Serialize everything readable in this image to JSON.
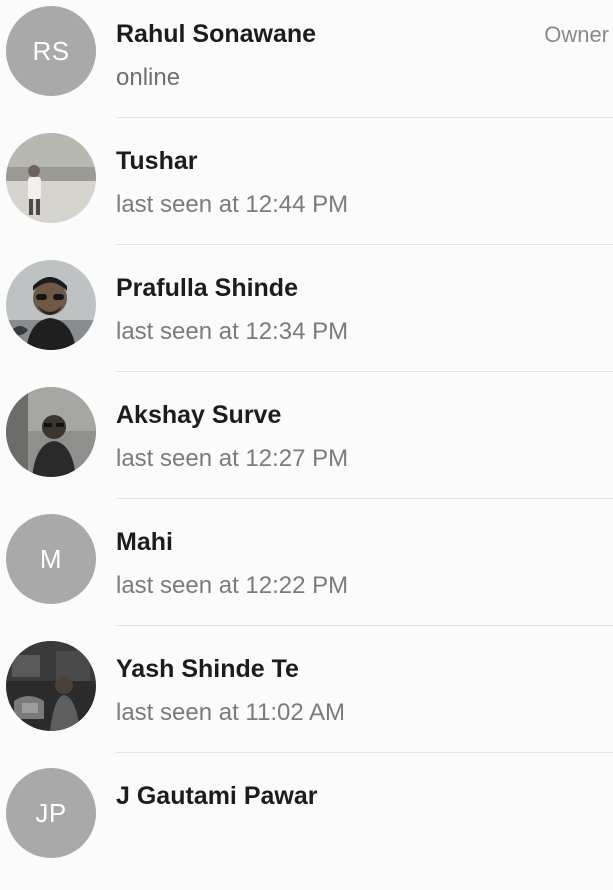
{
  "members": [
    {
      "name": "Rahul Sonawane",
      "status": "online",
      "role": "Owner",
      "avatar_initials": "RS",
      "avatar_color": "#a9a9a9"
    },
    {
      "name": "Tushar",
      "status": "last seen at 12:44 PM",
      "avatar_photo": "outdoor-photo"
    },
    {
      "name": "Prafulla Shinde",
      "status": "last seen at 12:34 PM",
      "avatar_photo": "portrait-sunglasses-photo"
    },
    {
      "name": "Akshay Surve",
      "status": "last seen at 12:27 PM",
      "avatar_photo": "portrait-photo"
    },
    {
      "name": "Mahi",
      "status": "last seen at 12:22 PM",
      "avatar_initials": "M",
      "avatar_color": "#a9a9a9"
    },
    {
      "name": "Yash Shinde Te",
      "status": "last seen at 11:02 AM",
      "avatar_photo": "dark-interior-photo"
    },
    {
      "name": "J Gautami Pawar",
      "status": "",
      "avatar_initials": "JP",
      "avatar_color": "#a9a9a9"
    }
  ]
}
